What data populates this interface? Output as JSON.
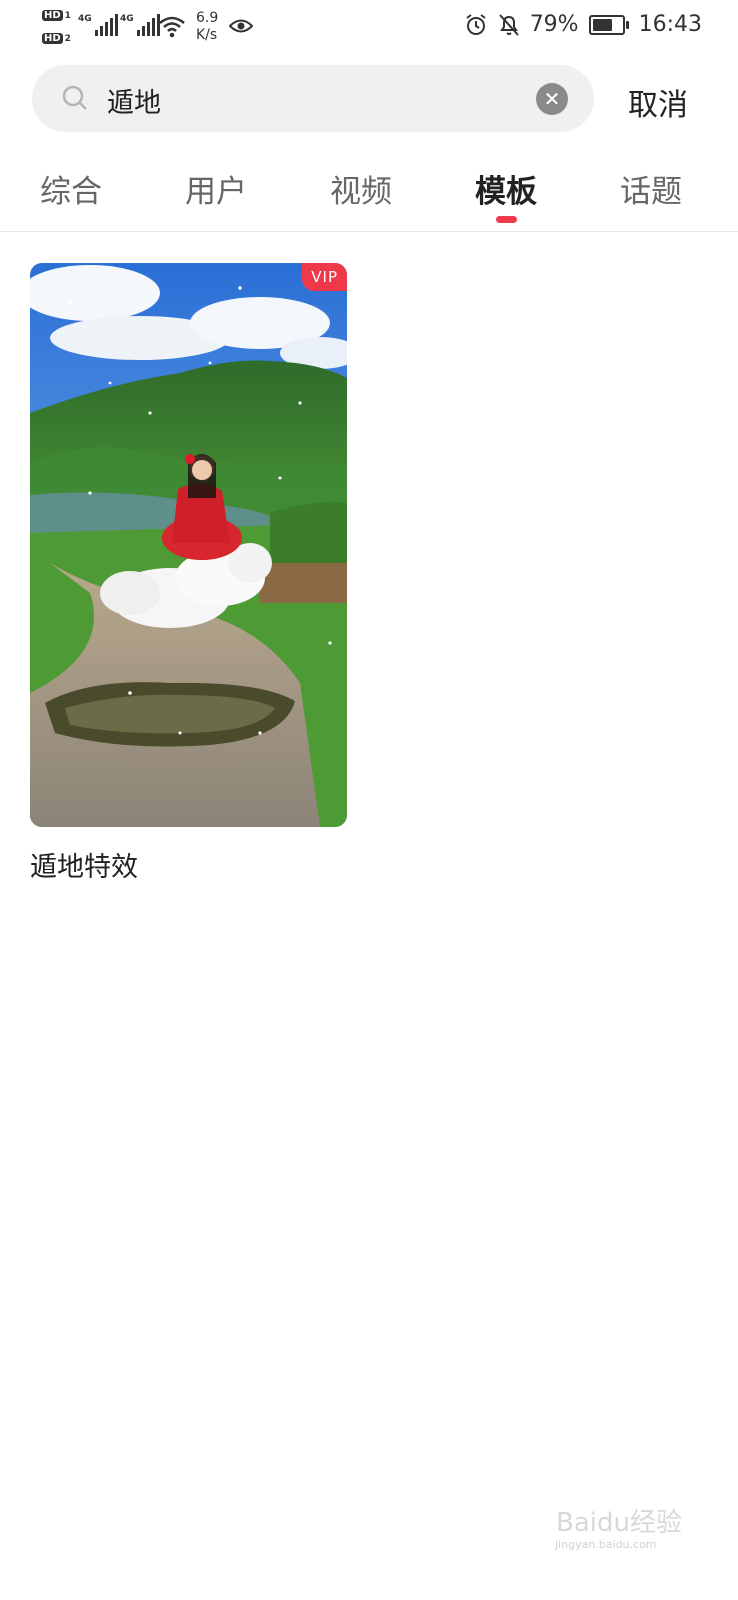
{
  "status_bar": {
    "hd1": "HD",
    "hd1_sub": "1",
    "hd2": "HD",
    "hd2_sub": "2",
    "net1": "4G",
    "net2": "4G",
    "speed_value": "6.9",
    "speed_unit": "K/s",
    "battery_percent": "79%",
    "battery_level": 0.79,
    "time": "16:43"
  },
  "search": {
    "query": "遁地",
    "cancel_label": "取消"
  },
  "tabs": [
    {
      "label": "综合",
      "active": false
    },
    {
      "label": "用户",
      "active": false
    },
    {
      "label": "视频",
      "active": false
    },
    {
      "label": "模板",
      "active": true
    },
    {
      "label": "话题",
      "active": false
    }
  ],
  "results": [
    {
      "title": "遁地特效",
      "badge": "VIP"
    }
  ],
  "watermark": {
    "logo": "Baidu经验",
    "url": "jingyan.baidu.com"
  },
  "colors": {
    "accent": "#ee3a4a",
    "vip_badge": "#f0384b",
    "search_bg": "#eef0f2"
  }
}
